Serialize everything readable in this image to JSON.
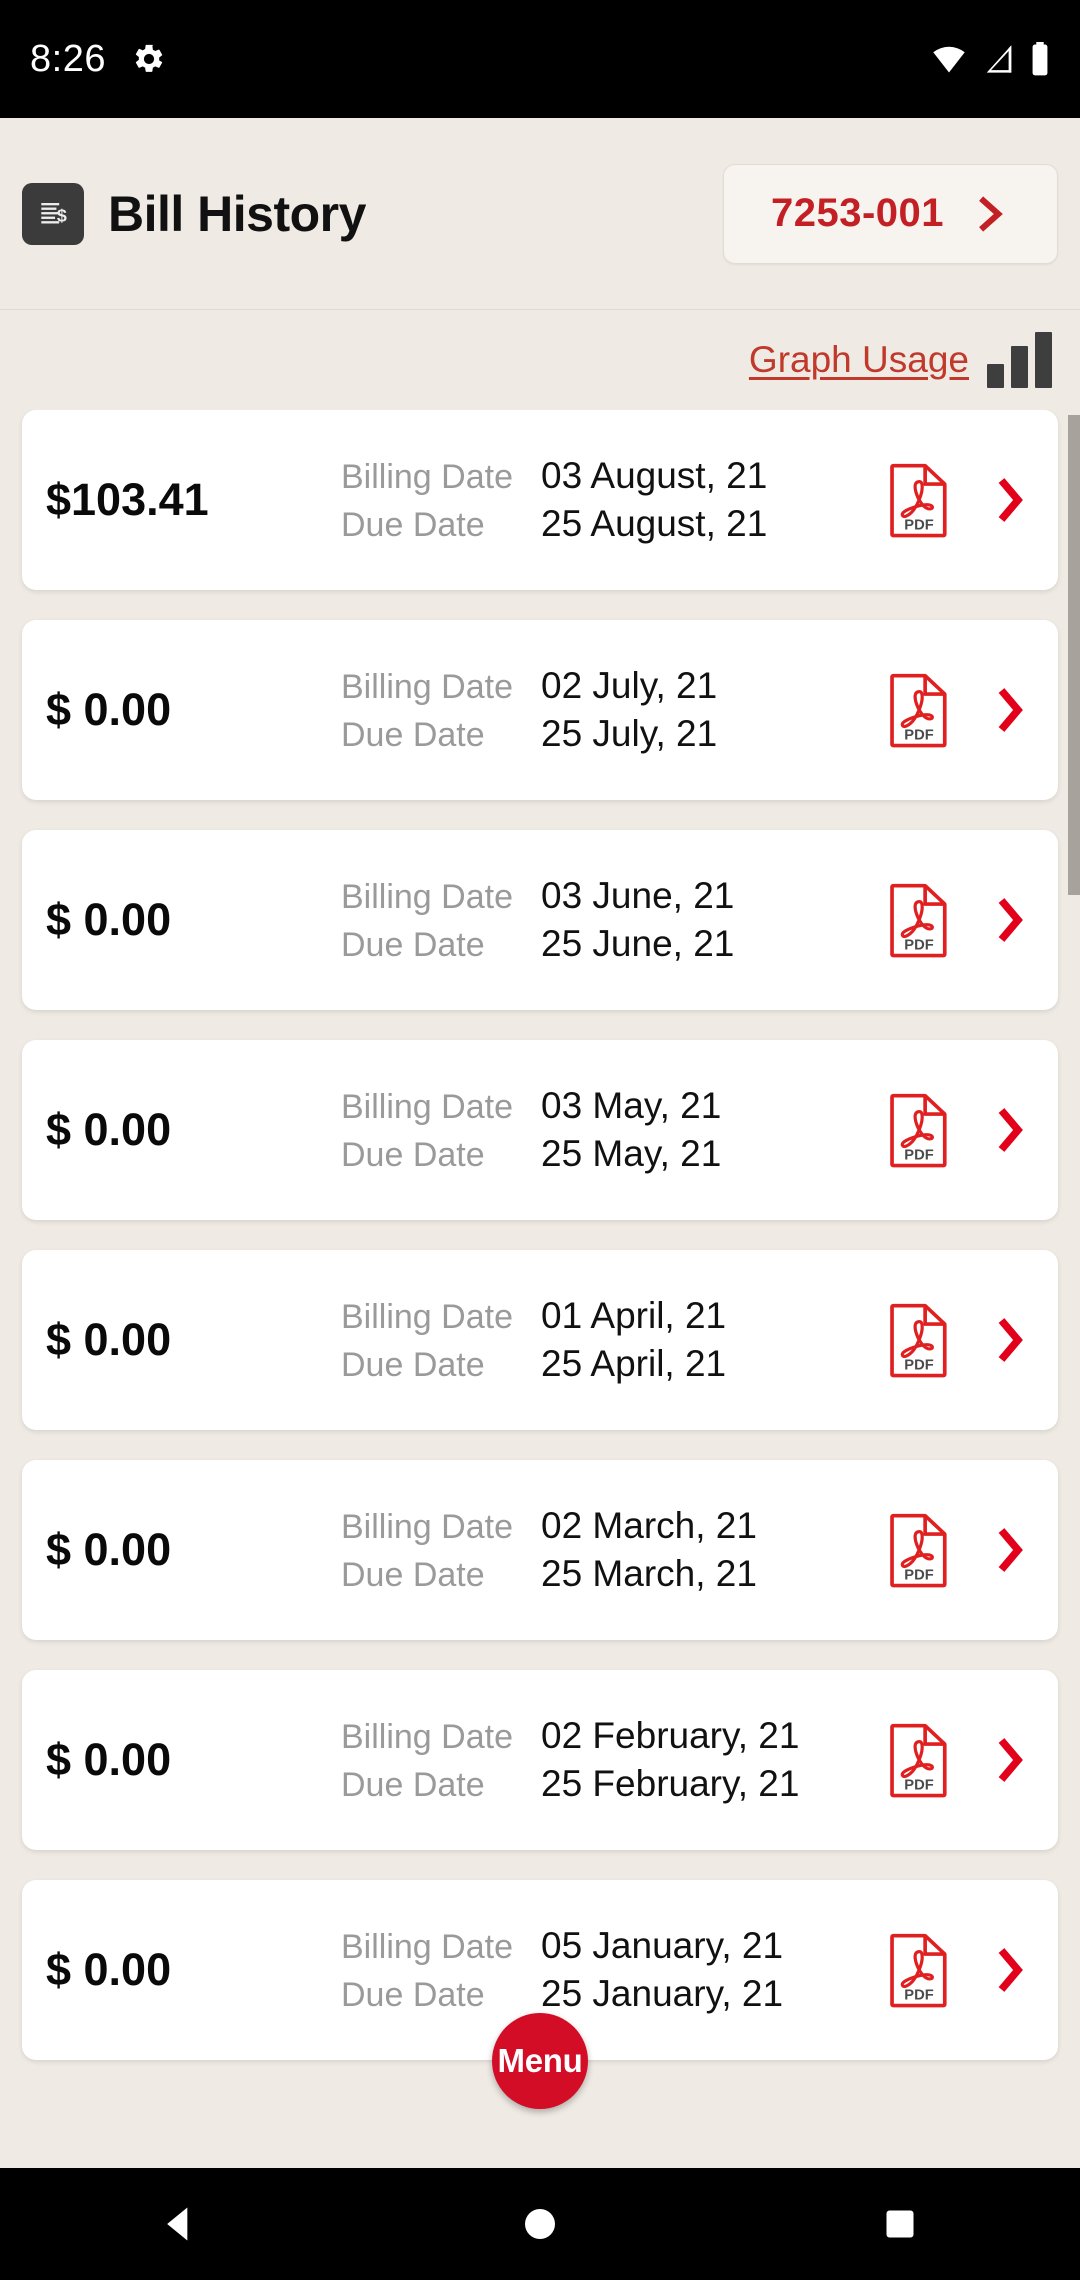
{
  "status_bar": {
    "time": "8:26",
    "icons": [
      "gear-icon",
      "wifi-icon",
      "cellular-signal-icon",
      "battery-icon"
    ]
  },
  "header": {
    "icon": "bill-document-icon",
    "title": "Bill History",
    "account_button": {
      "label": "7253-001",
      "chevron": "chevron-right-icon"
    }
  },
  "graph_usage": {
    "label": "Graph Usage",
    "icon": "bar-chart-icon"
  },
  "list": {
    "labels": {
      "billing_date": "Billing Date",
      "due_date": "Due Date"
    },
    "pdf_icon_label": "PDF",
    "rows": [
      {
        "amount": "$103.41",
        "billing_date": "03 August, 21",
        "due_date": "25 August, 21"
      },
      {
        "amount": "$ 0.00",
        "billing_date": "02 July, 21",
        "due_date": "25 July, 21"
      },
      {
        "amount": "$ 0.00",
        "billing_date": "03 June, 21",
        "due_date": "25 June, 21"
      },
      {
        "amount": "$ 0.00",
        "billing_date": "03 May, 21",
        "due_date": "25 May, 21"
      },
      {
        "amount": "$ 0.00",
        "billing_date": "01 April, 21",
        "due_date": "25 April, 21"
      },
      {
        "amount": "$ 0.00",
        "billing_date": "02 March, 21",
        "due_date": "25 March, 21"
      },
      {
        "amount": "$ 0.00",
        "billing_date": "02 February, 21",
        "due_date": "25 February, 21"
      },
      {
        "amount": "$ 0.00",
        "billing_date": "05 January, 21",
        "due_date": "25 January, 21"
      }
    ]
  },
  "fab": {
    "label": "Menu"
  },
  "nav_bar": {
    "back": "back-triangle-icon",
    "home": "home-circle-icon",
    "recents": "recents-square-icon"
  },
  "colors": {
    "brand_red": "#C32026",
    "fab_red": "#D40D27",
    "link_red": "#C0392B",
    "page_background": "#EFEAE4",
    "card_background": "#FFFFFF",
    "label_gray": "#9A9A9A",
    "icon_dark": "#3B3B3B",
    "scrollbar": "#A7A29C"
  }
}
